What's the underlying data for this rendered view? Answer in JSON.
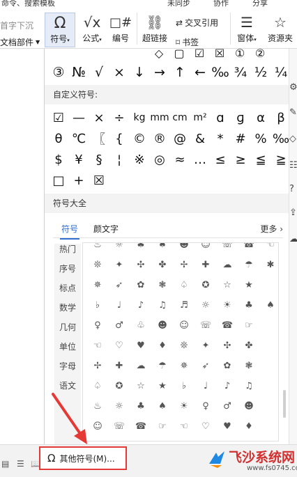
{
  "ribbon": {
    "top_menu": [
      "⁠命令、搜索模板",
      "未同步",
      "协作",
      "分享"
    ],
    "left_items": [
      "首字下沉",
      "文档部件"
    ],
    "buttons": [
      {
        "label": "符号",
        "icon": "omega-icon"
      },
      {
        "label": "公式",
        "icon": "formula-icon"
      },
      {
        "label": "编号",
        "icon": "numbering-icon"
      }
    ],
    "hyperlink_label": "超链接",
    "cross_ref_label": "交叉引用",
    "bookmark_label": "书签",
    "window_label": "窗体",
    "resource_label": "资源夹"
  },
  "panel": {
    "recent_partial": [
      "◇",
      "▢",
      "☑",
      "☒",
      "①",
      "②"
    ],
    "recent": [
      "③",
      "№",
      "√",
      "×",
      "↓",
      "→",
      "↑",
      "←",
      "‰",
      "¾",
      "½",
      "¼"
    ],
    "custom_title": "自定义符号:",
    "custom_symbols": [
      [
        "☑",
        "—",
        "×",
        "÷",
        "kg",
        "mm",
        "cm",
        "m²",
        "ɑ",
        "ɡ",
        "α",
        "β"
      ],
      [
        "θ",
        "℃",
        "〖",
        "{",
        "©",
        "®",
        "@",
        "&",
        "*",
        "#",
        "%",
        "‰"
      ],
      [
        "$",
        "¥",
        "§",
        "¦",
        "※",
        "◎",
        "≈",
        "…",
        "≤",
        "≥",
        "≦",
        "≧"
      ],
      [
        "□",
        "+",
        "☒"
      ]
    ],
    "all_title": "符号大全",
    "tabs": [
      "符号",
      "颜文字"
    ],
    "more_label": "更多",
    "categories": [
      "热门",
      "序号",
      "标点",
      "数学",
      "几何",
      "单位",
      "字母",
      "语文"
    ],
    "grid": [
      [
        "♨",
        "☼",
        "♣",
        "♠",
        "☻",
        "☺",
        "☏",
        "☎",
        "☜"
      ],
      [
        "❊",
        "✦",
        "✣",
        "✤",
        "✢",
        "✚",
        "☁",
        "☂",
        "✱"
      ],
      [
        "✵",
        "➶",
        "✿",
        "❃",
        "♤",
        "✪",
        "☆",
        "★",
        ""
      ],
      [
        "♭",
        "♩",
        "♪",
        "♫",
        "♬",
        "☼",
        "☀",
        "♣",
        "♠"
      ],
      [
        "♀",
        "♂",
        "♧",
        "☻",
        "☺",
        "☏",
        "☎",
        "☞",
        ""
      ],
      [
        "☜",
        "♡",
        "♥",
        "♦",
        "❊",
        "✦",
        "✣",
        "✤",
        ""
      ],
      [
        "✢",
        "✚",
        "☁",
        "☂",
        "✵",
        "➶",
        "✿",
        "❃",
        ""
      ],
      [
        "♤",
        "✪",
        "☆",
        "★",
        "♭",
        "♩",
        "♪",
        "♫",
        ""
      ],
      [
        "♨",
        "☼",
        "♣",
        "♠",
        "☀",
        "♀",
        "♂",
        "☻",
        ""
      ],
      [
        "☺",
        "☏",
        "☎",
        "☞",
        "☜",
        "♡",
        "♥",
        "♦",
        ""
      ]
    ]
  },
  "more_symbols_label": "其他符号(M)...",
  "watermark": {
    "text": "飞沙系统网",
    "url": "www.fs0745.com"
  }
}
